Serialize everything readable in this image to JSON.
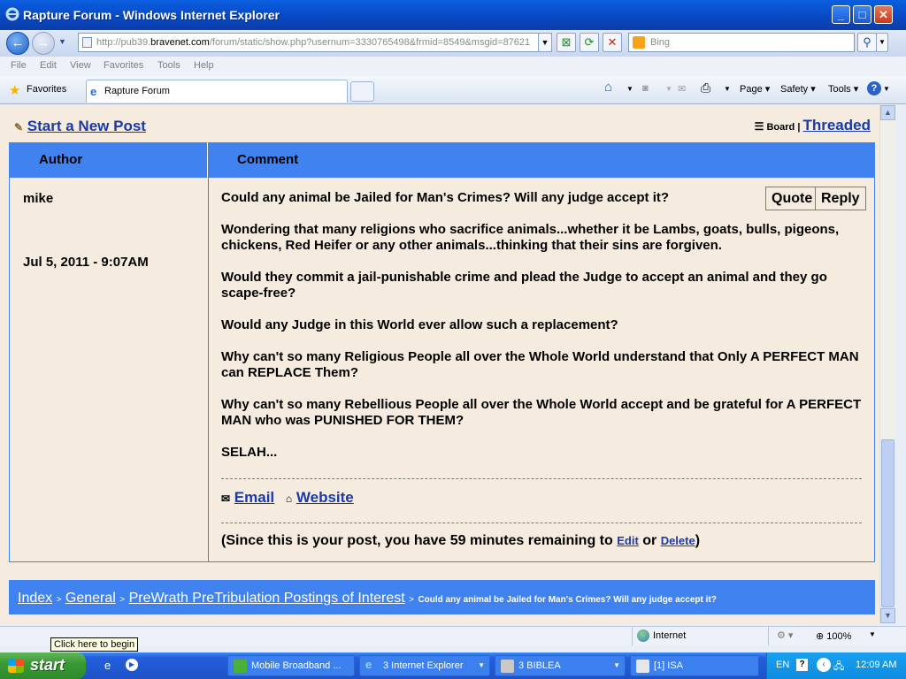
{
  "window": {
    "title": "Rapture Forum - Windows Internet Explorer"
  },
  "address": {
    "prefix": "http://pub39.",
    "domain": "bravenet.com",
    "path": "/forum/static/show.php?usernum=3330765498&frmid=8549&msgid=87621"
  },
  "search": {
    "placeholder": "Bing"
  },
  "menu": [
    "File",
    "Edit",
    "View",
    "Favorites",
    "Tools",
    "Help"
  ],
  "favorites_label": "Favorites",
  "tab_label": "Rapture Forum",
  "commands": [
    "Page",
    "Safety",
    "Tools"
  ],
  "forum": {
    "new_post": "Start a New Post",
    "board": "Board",
    "pipe": "|",
    "threaded": "Threaded",
    "header_author": "Author",
    "header_comment": "Comment",
    "author": "mike",
    "date": "Jul 5, 2011 - 9:07AM",
    "quote": "Quote",
    "reply": "Reply",
    "paragraphs": [
      "Could any animal be Jailed for Man's Crimes? Will any judge accept it?",
      "Wondering that many religions who sacrifice animals...whether it be Lambs, goats, bulls, pigeons, chickens, Red Heifer or any other animals...thinking that their sins are forgiven.",
      "Would they commit a jail-punishable crime and plead the Judge to accept an animal and they go scape-free?",
      "Would any Judge in this World ever allow such a replacement?",
      "Why can't so many Religious People all over the Whole World understand that Only A PERFECT MAN can REPLACE Them?",
      "Why can't so many Rebellious People all over the Whole World accept and be grateful for A PERFECT MAN who was PUNISHED FOR THEM?",
      "SELAH..."
    ],
    "email": "Email",
    "website": "Website",
    "notice_pre": "(Since this is your post, you have 59 minutes remaining to",
    "edit": "Edit",
    "or": "or",
    "delete": "Delete",
    "notice_post": ")",
    "breadcrumb": {
      "index": "Index",
      "general": "General",
      "section": "PreWrath PreTribulation Postings of Interest",
      "topic": "Could any animal be Jailed for Man's Crimes? Will any judge accept it?",
      "sep": ">"
    }
  },
  "status": {
    "zone": "Internet",
    "zoom": "100%"
  },
  "tooltip": "Click here to begin",
  "taskbar": {
    "start": "start",
    "tasks": [
      "Mobile Broadband ...",
      "3 Internet Explorer",
      "3 BIBLEA",
      "[1] ISA"
    ],
    "lang": "EN",
    "clock": "12:09 AM"
  }
}
